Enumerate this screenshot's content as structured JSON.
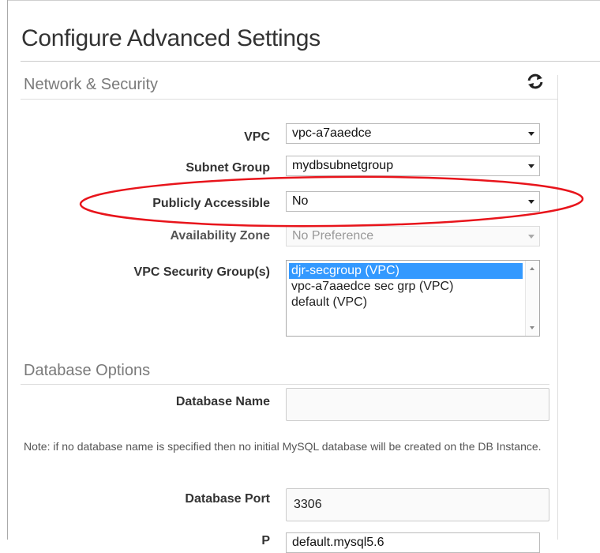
{
  "page": {
    "title": "Configure Advanced Settings"
  },
  "network_security": {
    "heading": "Network & Security",
    "refresh_icon": "refresh-icon",
    "vpc": {
      "label": "VPC",
      "value": "vpc-a7aaedce"
    },
    "subnet_group": {
      "label": "Subnet Group",
      "value": "mydbsubnetgroup"
    },
    "publicly_accessible": {
      "label": "Publicly Accessible",
      "value": "No"
    },
    "availability_zone": {
      "label": "Availability Zone",
      "value": "No Preference"
    },
    "security_groups": {
      "label": "VPC Security Group(s)",
      "options": [
        {
          "label": "djr-secgroup (VPC)",
          "selected": true
        },
        {
          "label": "vpc-a7aaedce sec grp (VPC)",
          "selected": false
        },
        {
          "label": "default (VPC)",
          "selected": false
        }
      ]
    }
  },
  "database_options": {
    "heading": "Database Options",
    "database_name": {
      "label": "Database Name",
      "value": ""
    },
    "note": "Note: if no database name is specified then no initial MySQL database will be created on the DB Instance.",
    "database_port": {
      "label": "Database Port",
      "value": "3306"
    },
    "partial_label": "P",
    "partial_value": "default.mysql5.6"
  },
  "colors": {
    "annotation": "#e8141b",
    "selection": "#3399ff"
  }
}
